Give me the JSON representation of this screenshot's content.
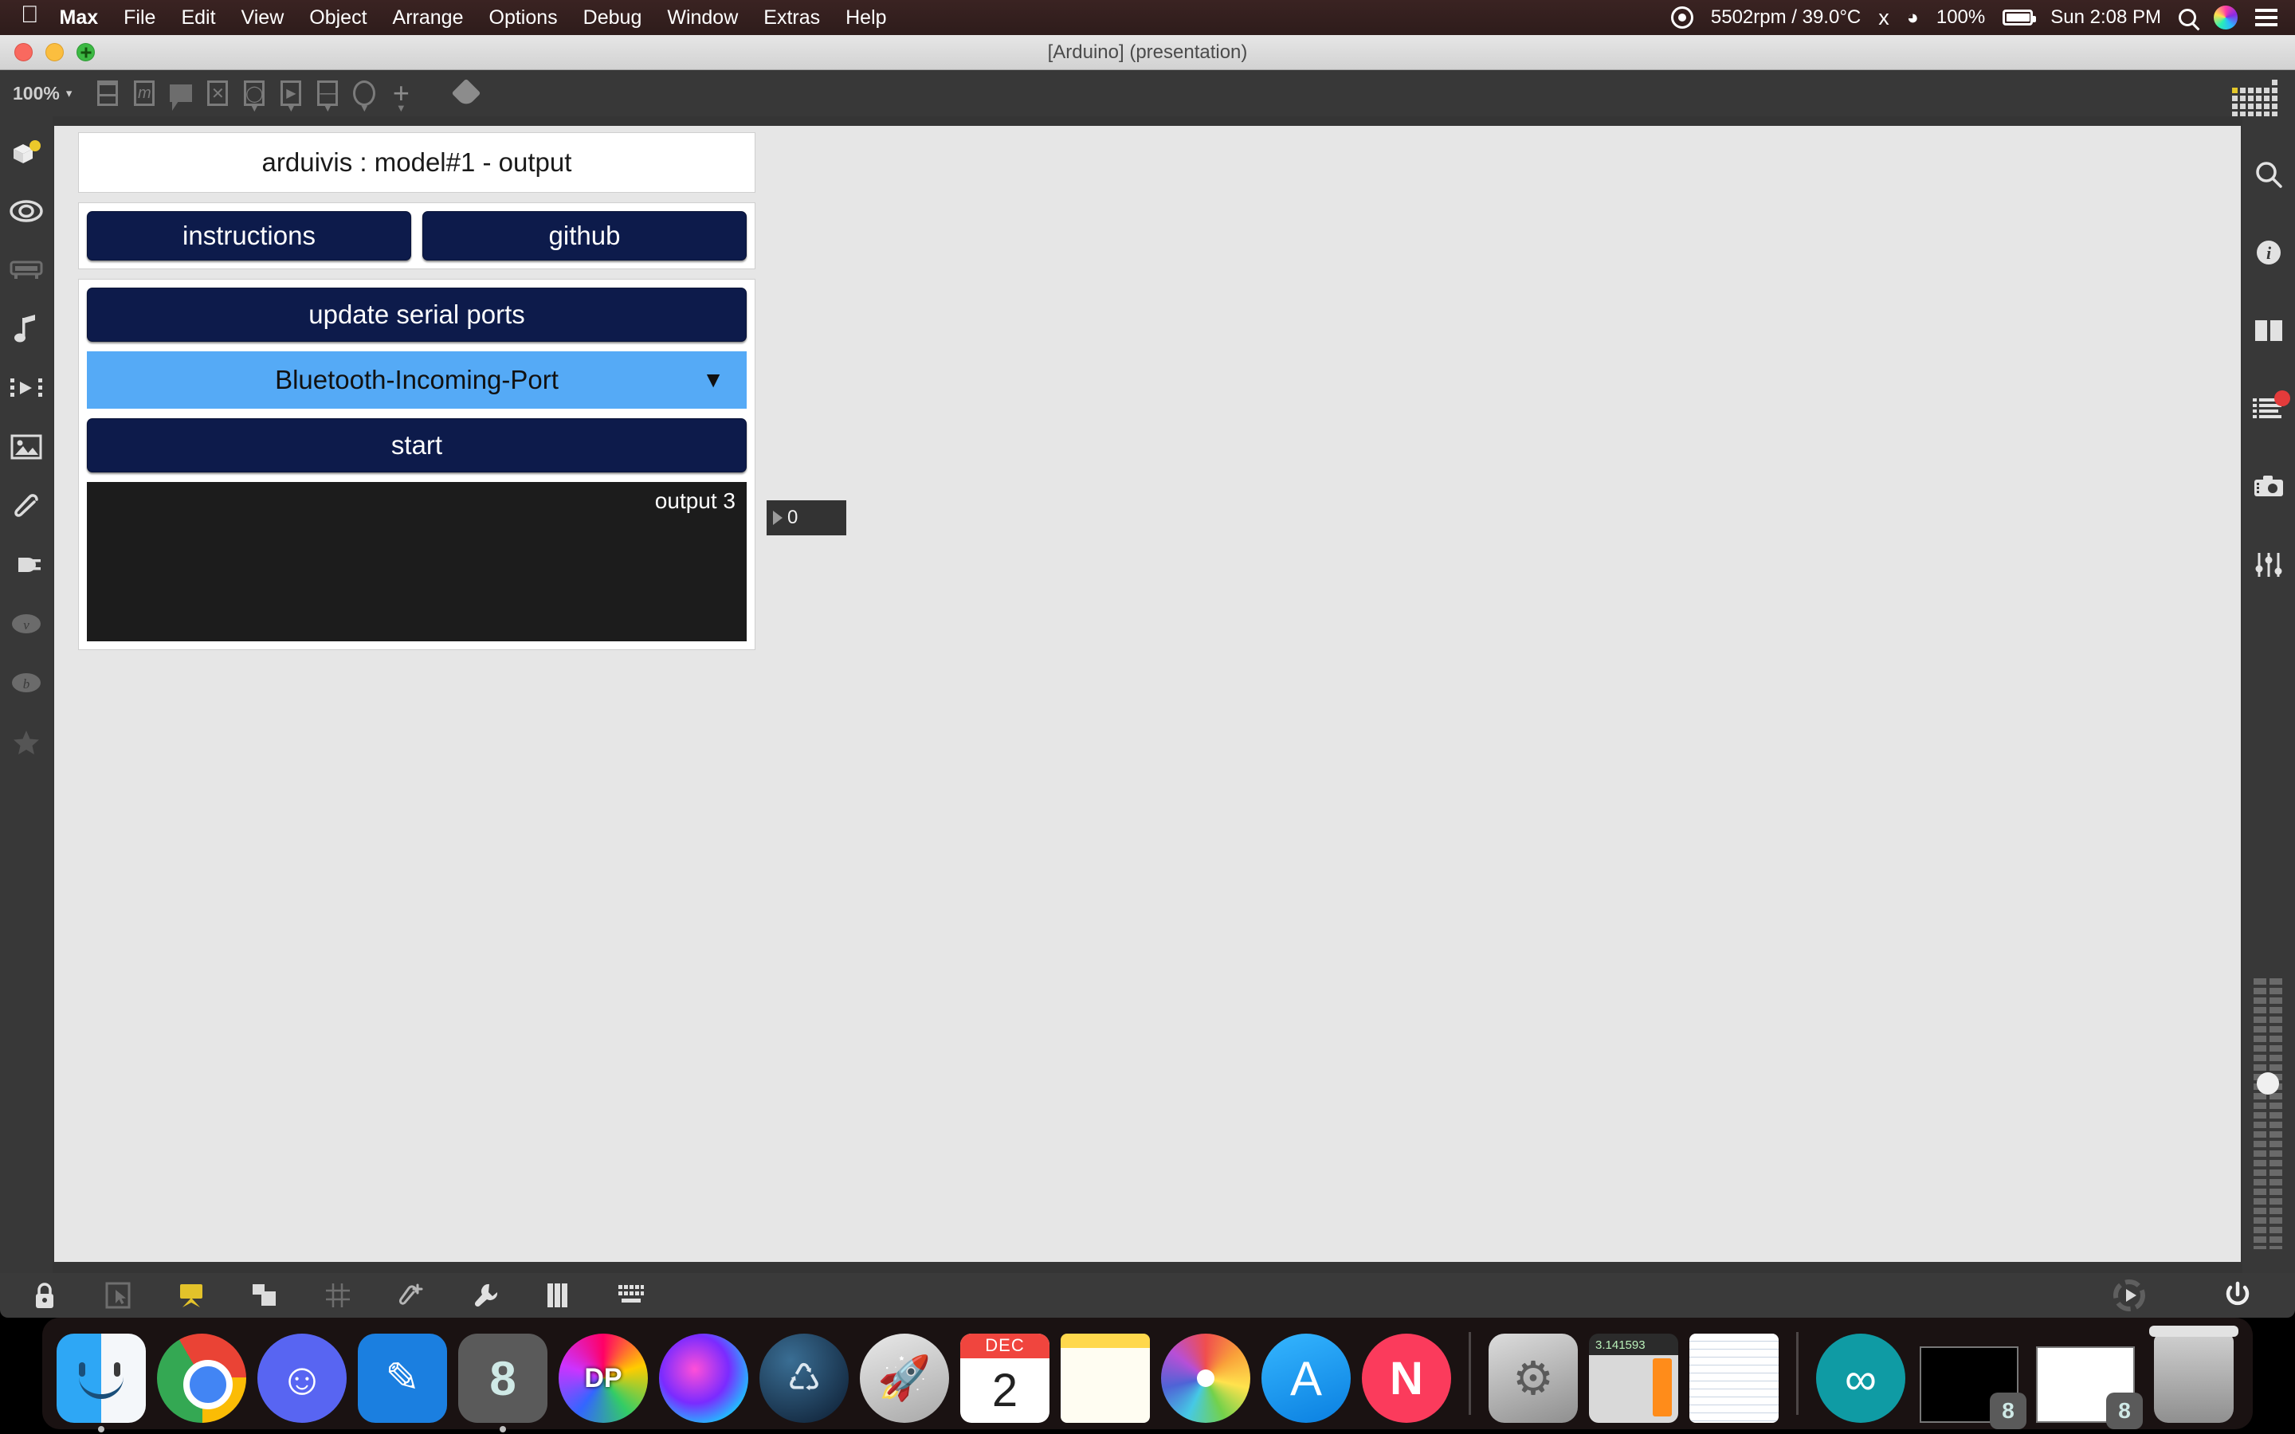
{
  "menubar": {
    "apple_icon": "apple-logo",
    "items": [
      {
        "label": "Max",
        "bold": true
      },
      {
        "label": "File",
        "bold": false
      },
      {
        "label": "Edit",
        "bold": false
      },
      {
        "label": "View",
        "bold": false
      },
      {
        "label": "Object",
        "bold": false
      },
      {
        "label": "Arrange",
        "bold": false
      },
      {
        "label": "Options",
        "bold": false
      },
      {
        "label": "Debug",
        "bold": false
      },
      {
        "label": "Window",
        "bold": false
      },
      {
        "label": "Extras",
        "bold": false
      },
      {
        "label": "Help",
        "bold": false
      }
    ],
    "status": {
      "fan_icon": "fan-icon",
      "fan_text": "5502rpm / 39.0°C",
      "bluetooth_icon": "bluetooth-icon",
      "wifi_icon": "wifi-icon",
      "battery_percent": "100%",
      "battery_icon": "battery-icon",
      "clock": "Sun 2:08 PM",
      "search_icon": "search-icon",
      "siri_icon": "siri-icon",
      "control_center_icon": "control-center-icon"
    }
  },
  "window": {
    "title": "[Arduino] (presentation)",
    "traffic_lights": [
      "close",
      "minimize",
      "zoom"
    ]
  },
  "toolbar": {
    "zoom_level": "100%",
    "zoom_caret": "▾",
    "icons": [
      {
        "name": "object-box-icon",
        "glyph": ""
      },
      {
        "name": "message-box-icon",
        "glyph": "m"
      },
      {
        "name": "comment-icon",
        "glyph": ""
      },
      {
        "name": "toggle-icon",
        "glyph": "X"
      },
      {
        "name": "button-bang-icon",
        "glyph": "O"
      },
      {
        "name": "playbar-icon",
        "glyph": "▶"
      },
      {
        "name": "slider-icon",
        "glyph": "—"
      },
      {
        "name": "dial-icon",
        "glyph": ""
      },
      {
        "name": "add-object-icon",
        "glyph": "+"
      },
      {
        "name": "paint-bucket-icon",
        "glyph": ""
      }
    ],
    "matrix_icon": "matrix-grid-icon"
  },
  "sidebar_left": {
    "items": [
      {
        "name": "packages-icon",
        "badge": true
      },
      {
        "name": "eye-icon",
        "badge": false
      },
      {
        "name": "keyboard-object-icon",
        "badge": false
      },
      {
        "name": "music-note-icon",
        "badge": false
      },
      {
        "name": "video-playback-icon",
        "badge": false
      },
      {
        "name": "image-icon",
        "badge": false
      },
      {
        "name": "paperclip-icon",
        "badge": false
      },
      {
        "name": "plug-icon",
        "badge": false
      },
      {
        "name": "vizzie-icon",
        "badge": false
      },
      {
        "name": "beap-icon",
        "badge": false
      },
      {
        "name": "favorites-star-icon",
        "badge": false
      }
    ]
  },
  "sidebar_right": {
    "items": [
      {
        "name": "search-icon",
        "badge": false
      },
      {
        "name": "info-icon",
        "badge": false
      },
      {
        "name": "panel-split-icon",
        "badge": false
      },
      {
        "name": "console-list-icon",
        "badge": true
      },
      {
        "name": "snapshot-camera-icon",
        "badge": false
      },
      {
        "name": "mixer-sliders-icon",
        "badge": false
      }
    ],
    "meter": {
      "name": "level-meter",
      "value": 0
    }
  },
  "patcher": {
    "title_box": "arduivis : model#1 - output",
    "buttons": {
      "instructions": "instructions",
      "github": "github",
      "update_serial_ports": "update serial ports",
      "start": "start"
    },
    "dropdown": {
      "selected": "Bluetooth-Incoming-Port",
      "arrow": "▼"
    },
    "console": {
      "label": "output 3",
      "content": ""
    },
    "number_box": {
      "value": "0",
      "triangle": "▶"
    },
    "colors": {
      "button_bg": "#0d1b4b",
      "dropdown_bg": "#55aaf6",
      "console_bg": "#1c1c1c",
      "canvas_bg": "#e6e6e6"
    }
  },
  "bottombar": {
    "icons": [
      {
        "name": "lock-icon",
        "active": false
      },
      {
        "name": "edit-cursor-icon",
        "active": false
      },
      {
        "name": "presentation-mode-icon",
        "active": true
      },
      {
        "name": "copy-layers-icon",
        "active": false
      },
      {
        "name": "grid-snap-icon",
        "active": false
      },
      {
        "name": "add-clipping-icon",
        "active": false
      },
      {
        "name": "inspector-wrench-icon",
        "active": false
      },
      {
        "name": "piano-keys-icon",
        "active": false
      },
      {
        "name": "computer-keyboard-icon",
        "active": false
      }
    ],
    "right_icons": [
      {
        "name": "transport-play-icon"
      },
      {
        "name": "audio-power-icon"
      }
    ]
  },
  "dock": {
    "items": [
      {
        "name": "finder",
        "label": "Finder",
        "running": true
      },
      {
        "name": "chrome",
        "label": "Google Chrome",
        "running": false
      },
      {
        "name": "discord",
        "label": "Discord",
        "running": false
      },
      {
        "name": "xcode",
        "label": "Xcode",
        "running": false
      },
      {
        "name": "max",
        "label": "Max",
        "running": true
      },
      {
        "name": "digital-performer",
        "label": "DP",
        "running": false
      },
      {
        "name": "siri",
        "label": "Siri",
        "running": false
      },
      {
        "name": "steam",
        "label": "Steam",
        "running": false
      },
      {
        "name": "launchpad",
        "label": "Launchpad",
        "running": false
      },
      {
        "name": "calendar",
        "label": "Calendar",
        "running": false
      },
      {
        "name": "notes",
        "label": "Notes",
        "running": false
      },
      {
        "name": "photos",
        "label": "Photos",
        "running": false
      },
      {
        "name": "app-store",
        "label": "App Store",
        "running": false
      },
      {
        "name": "news",
        "label": "News",
        "running": false
      },
      {
        "name": "system-preferences",
        "label": "System Preferences",
        "running": false
      },
      {
        "name": "calculator",
        "label": "Calculator",
        "running": false
      },
      {
        "name": "textedit",
        "label": "TextEdit",
        "running": false
      },
      {
        "name": "arduino",
        "label": "Arduino",
        "running": false
      }
    ],
    "calendar": {
      "month": "DEC",
      "day": "2"
    },
    "calculator_display": "3.141593",
    "max_glyph": "8",
    "minimized_windows": [
      {
        "name": "max-console-window",
        "badge": "8"
      },
      {
        "name": "max-patcher-window",
        "badge": "8"
      }
    ],
    "trash": {
      "name": "trash",
      "full": true
    }
  }
}
